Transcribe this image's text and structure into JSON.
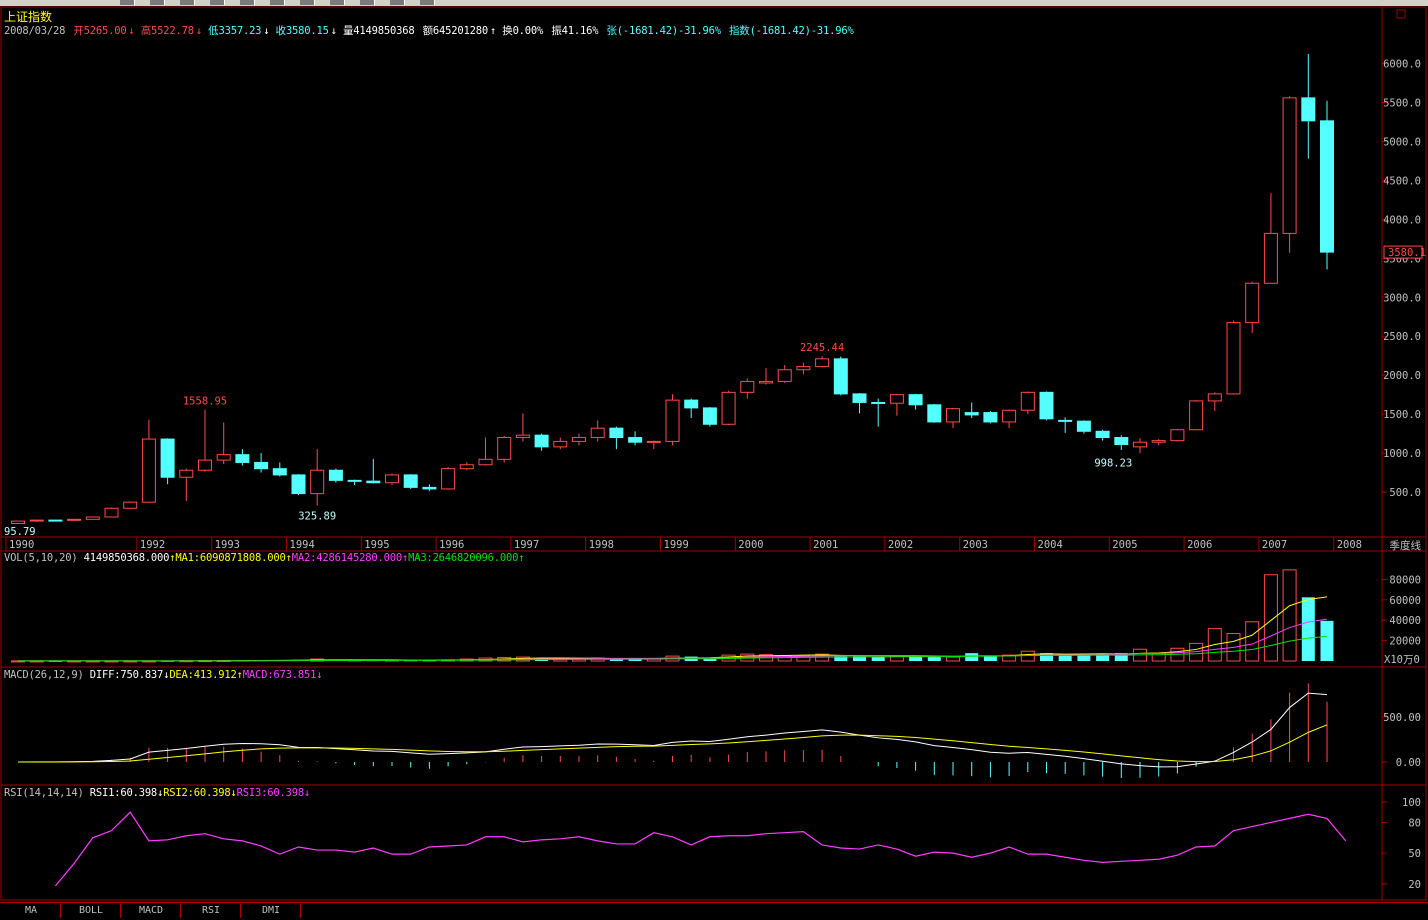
{
  "index_name": "上证指数",
  "period_label": "季度线",
  "quote": {
    "date": "2008/03/28",
    "open": "开5265.00",
    "high": "高5522.78",
    "low": "低3357.23",
    "close": "收3580.15",
    "volume": "量4149850368",
    "amount": "额645201280",
    "turnover": "换0.00%",
    "amplitude": "振41.16%",
    "change": "张(-1681.42)-31.96%",
    "index_change": "指数(-1681.42)-31.96%"
  },
  "price_axis": [
    "6000.0",
    "5500.0",
    "5000.0",
    "4500.0",
    "4000.0",
    "3500.0",
    "3000.0",
    "2500.0",
    "2000.0",
    "1500.0",
    "1000.0",
    "500.0"
  ],
  "current_price_label": "3580.1",
  "annotations": {
    "a1": "1558.95",
    "a2": "325.89",
    "a3": "2245.44",
    "a4": "998.23",
    "a5": "95.79"
  },
  "year_labels": [
    "1990",
    "1992",
    "1993",
    "1994",
    "1995",
    "1996",
    "1997",
    "1998",
    "1999",
    "2000",
    "2001",
    "2002",
    "2003",
    "2004",
    "2005",
    "2006",
    "2007",
    "2008"
  ],
  "volume_panel": {
    "header": "VOL(5,10,20)",
    "value": "4149850368.000",
    "ma1": "MA1:6090871808.000",
    "ma2": "MA2:4286145280.000",
    "ma3": "MA3:2646820096.000",
    "axis": [
      "80000",
      "60000",
      "40000",
      "20000"
    ],
    "unit": "X10万0"
  },
  "macd_panel": {
    "header": "MACD(26,12,9)",
    "diff": "DIFF:750.837",
    "dea": "DEA:413.912",
    "macd": "MACD:673.851",
    "axis": [
      "500.00",
      "0.00"
    ]
  },
  "rsi_panel": {
    "header": "RSI(14,14,14)",
    "rsi1": "RSI1:60.398",
    "rsi2": "RSI2:60.398",
    "rsi3": "RSI3:60.398",
    "axis": [
      "100",
      "80",
      "50",
      "20"
    ]
  },
  "tabs": [
    "MA",
    "BOLL",
    "MACD",
    "RSI",
    "DMI"
  ],
  "colors": {
    "up": "#ff4a4a",
    "down": "#54ffff",
    "frame": "#a00000",
    "yellow": "#ffff00",
    "magenta": "#ff3dff",
    "green": "#00e000",
    "white": "#ffffff"
  },
  "chart_data": {
    "type": "candlestick",
    "period": "quarterly",
    "candles": [
      {
        "o": 96,
        "c": 127,
        "h": 130,
        "l": 96
      },
      {
        "o": 127,
        "c": 140,
        "h": 143,
        "l": 125
      },
      {
        "o": 140,
        "c": 137,
        "h": 142,
        "l": 134
      },
      {
        "o": 137,
        "c": 150,
        "h": 153,
        "l": 135
      },
      {
        "o": 150,
        "c": 180,
        "h": 184,
        "l": 149
      },
      {
        "o": 180,
        "c": 292,
        "h": 300,
        "l": 178
      },
      {
        "o": 292,
        "c": 370,
        "h": 380,
        "l": 288
      },
      {
        "o": 370,
        "c": 1180,
        "h": 1429,
        "l": 365
      },
      {
        "o": 1180,
        "c": 690,
        "h": 1190,
        "l": 600
      },
      {
        "o": 690,
        "c": 780,
        "h": 800,
        "l": 386
      },
      {
        "o": 780,
        "c": 910,
        "h": 1559,
        "l": 760
      },
      {
        "o": 910,
        "c": 980,
        "h": 1392,
        "l": 860
      },
      {
        "o": 980,
        "c": 880,
        "h": 1050,
        "l": 840
      },
      {
        "o": 880,
        "c": 800,
        "h": 1000,
        "l": 750
      },
      {
        "o": 800,
        "c": 720,
        "h": 880,
        "l": 700
      },
      {
        "o": 720,
        "c": 480,
        "h": 730,
        "l": 460
      },
      {
        "o": 480,
        "c": 780,
        "h": 1052,
        "l": 326
      },
      {
        "o": 780,
        "c": 650,
        "h": 800,
        "l": 620
      },
      {
        "o": 650,
        "c": 640,
        "h": 660,
        "l": 590
      },
      {
        "o": 640,
        "c": 620,
        "h": 926,
        "l": 610
      },
      {
        "o": 620,
        "c": 720,
        "h": 740,
        "l": 590
      },
      {
        "o": 720,
        "c": 560,
        "h": 730,
        "l": 540
      },
      {
        "o": 560,
        "c": 540,
        "h": 600,
        "l": 512
      },
      {
        "o": 540,
        "c": 800,
        "h": 820,
        "l": 530
      },
      {
        "o": 800,
        "c": 850,
        "h": 880,
        "l": 780
      },
      {
        "o": 850,
        "c": 920,
        "h": 1200,
        "l": 840
      },
      {
        "o": 920,
        "c": 1200,
        "h": 1220,
        "l": 880
      },
      {
        "o": 1200,
        "c": 1230,
        "h": 1510,
        "l": 1150
      },
      {
        "o": 1230,
        "c": 1080,
        "h": 1250,
        "l": 1030
      },
      {
        "o": 1080,
        "c": 1150,
        "h": 1200,
        "l": 1050
      },
      {
        "o": 1150,
        "c": 1200,
        "h": 1250,
        "l": 1100
      },
      {
        "o": 1200,
        "c": 1320,
        "h": 1420,
        "l": 1150
      },
      {
        "o": 1320,
        "c": 1200,
        "h": 1340,
        "l": 1050
      },
      {
        "o": 1200,
        "c": 1140,
        "h": 1280,
        "l": 1100
      },
      {
        "o": 1140,
        "c": 1150,
        "h": 1160,
        "l": 1050
      },
      {
        "o": 1150,
        "c": 1680,
        "h": 1756,
        "l": 1100
      },
      {
        "o": 1680,
        "c": 1580,
        "h": 1700,
        "l": 1450
      },
      {
        "o": 1580,
        "c": 1370,
        "h": 1590,
        "l": 1340
      },
      {
        "o": 1370,
        "c": 1780,
        "h": 1800,
        "l": 1360
      },
      {
        "o": 1780,
        "c": 1920,
        "h": 1960,
        "l": 1700
      },
      {
        "o": 1900,
        "c": 1920,
        "h": 2090,
        "l": 1880
      },
      {
        "o": 1920,
        "c": 2070,
        "h": 2130,
        "l": 1900
      },
      {
        "o": 2070,
        "c": 2110,
        "h": 2160,
        "l": 2010
      },
      {
        "o": 2110,
        "c": 2210,
        "h": 2245,
        "l": 2100
      },
      {
        "o": 2210,
        "c": 1760,
        "h": 2240,
        "l": 1740
      },
      {
        "o": 1760,
        "c": 1650,
        "h": 1770,
        "l": 1510
      },
      {
        "o": 1650,
        "c": 1640,
        "h": 1700,
        "l": 1340
      },
      {
        "o": 1640,
        "c": 1750,
        "h": 1760,
        "l": 1480
      },
      {
        "o": 1750,
        "c": 1620,
        "h": 1760,
        "l": 1560
      },
      {
        "o": 1620,
        "c": 1400,
        "h": 1630,
        "l": 1390
      },
      {
        "o": 1400,
        "c": 1570,
        "h": 1580,
        "l": 1320
      },
      {
        "o": 1520,
        "c": 1490,
        "h": 1650,
        "l": 1450
      },
      {
        "o": 1520,
        "c": 1400,
        "h": 1540,
        "l": 1380
      },
      {
        "o": 1400,
        "c": 1550,
        "h": 1560,
        "l": 1320
      },
      {
        "o": 1550,
        "c": 1780,
        "h": 1790,
        "l": 1500
      },
      {
        "o": 1780,
        "c": 1440,
        "h": 1790,
        "l": 1420
      },
      {
        "o": 1420,
        "c": 1410,
        "h": 1460,
        "l": 1260
      },
      {
        "o": 1410,
        "c": 1280,
        "h": 1420,
        "l": 1250
      },
      {
        "o": 1280,
        "c": 1200,
        "h": 1300,
        "l": 1160
      },
      {
        "o": 1200,
        "c": 1110,
        "h": 1230,
        "l": 1040
      },
      {
        "o": 1080,
        "c": 1140,
        "h": 1190,
        "l": 998
      },
      {
        "o": 1140,
        "c": 1160,
        "h": 1180,
        "l": 1100
      },
      {
        "o": 1160,
        "c": 1300,
        "h": 1310,
        "l": 1150
      },
      {
        "o": 1300,
        "c": 1670,
        "h": 1680,
        "l": 1290
      },
      {
        "o": 1670,
        "c": 1760,
        "h": 1780,
        "l": 1540
      },
      {
        "o": 1760,
        "c": 2675,
        "h": 2700,
        "l": 1750
      },
      {
        "o": 2675,
        "c": 3180,
        "h": 3200,
        "l": 2540
      },
      {
        "o": 3180,
        "c": 3820,
        "h": 4335,
        "l": 3180
      },
      {
        "o": 3820,
        "c": 5560,
        "h": 5580,
        "l": 3570
      },
      {
        "o": 5560,
        "c": 5265,
        "h": 6124,
        "l": 4780
      },
      {
        "o": 5265,
        "c": 3580,
        "h": 5523,
        "l": 3357
      }
    ],
    "volume_values": [
      0.1,
      0.1,
      0.1,
      0.1,
      0.1,
      0.1,
      0.1,
      0.1,
      0.2,
      0.3,
      0.4,
      0.5,
      0.6,
      0.8,
      1.0,
      1.2,
      2.0,
      1.5,
      0.8,
      0.9,
      1.0,
      0.8,
      0.7,
      1.2,
      2.0,
      3.0,
      3.5,
      4.0,
      2.5,
      2.0,
      2.5,
      3.0,
      2.5,
      2.2,
      2.0,
      5.0,
      4.5,
      3.0,
      6.0,
      7.0,
      6.5,
      5.5,
      5.0,
      7.0,
      5.0,
      5.0,
      4.5,
      5.0,
      5.0,
      4.0,
      4.0,
      8.0,
      5.0,
      6.0,
      10.0,
      8.0,
      6.0,
      6.0,
      7.0,
      8.0,
      12.0,
      8.0,
      13.0,
      18.0,
      33.0,
      28.0,
      40.0,
      88.0,
      93.0,
      65.0,
      41.0
    ],
    "rsi_values": [
      18,
      40,
      65,
      72,
      90,
      62,
      63,
      67,
      69,
      64,
      62,
      57,
      49,
      56,
      53,
      53,
      51,
      55,
      49,
      49,
      56,
      57,
      58,
      66,
      66,
      61,
      63,
      64,
      66,
      62,
      59,
      59,
      70,
      66,
      58,
      66,
      67,
      67,
      69,
      70,
      71,
      58,
      55,
      54,
      58,
      54,
      47,
      51,
      50,
      46,
      50,
      56,
      49,
      49,
      46,
      43,
      41,
      42,
      43,
      44,
      48,
      56,
      57,
      72,
      76,
      80,
      84,
      88,
      84,
      62
    ],
    "axis_price": {
      "min": 0,
      "max": 6200
    },
    "year_markers": [
      {
        "year": "1990",
        "idx": 0
      },
      {
        "year": "1992",
        "idx": 7
      },
      {
        "year": "1993",
        "idx": 11
      },
      {
        "year": "1994",
        "idx": 15
      },
      {
        "year": "1995",
        "idx": 19
      },
      {
        "year": "1996",
        "idx": 23
      },
      {
        "year": "1997",
        "idx": 27
      },
      {
        "year": "1998",
        "idx": 31
      },
      {
        "year": "1999",
        "idx": 35
      },
      {
        "year": "2000",
        "idx": 39
      },
      {
        "year": "2001",
        "idx": 43
      },
      {
        "year": "2002",
        "idx": 47
      },
      {
        "year": "2003",
        "idx": 51
      },
      {
        "year": "2004",
        "idx": 55
      },
      {
        "year": "2005",
        "idx": 59
      },
      {
        "year": "2006",
        "idx": 63
      },
      {
        "year": "2007",
        "idx": 67
      },
      {
        "year": "2008",
        "idx": 71
      }
    ]
  }
}
